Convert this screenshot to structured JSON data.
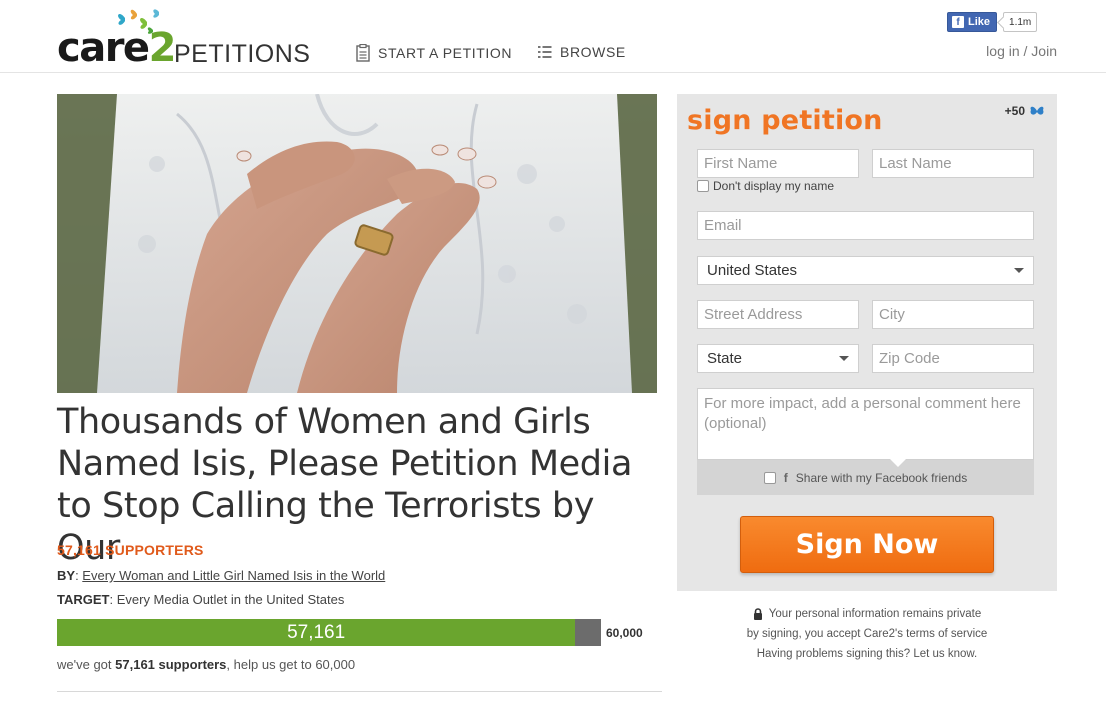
{
  "header": {
    "logo_brand": "care2",
    "logo_brand_main": "care",
    "logo_brand_num": "2",
    "logo_product": "PETITIONS",
    "nav": {
      "start_label": "START A PETITION",
      "browse_label": "BROWSE"
    },
    "facebook": {
      "like_label": "Like",
      "like_count": "1.1m"
    },
    "login_label": "log in / Join"
  },
  "petition": {
    "hero_alt": "Woman with hands crossed over her heart wearing a ring",
    "title": "Thousands of Women and Girls Named Isis, Please Petition Media to Stop Calling the Terrorists by Our",
    "supporters_label": "57,161 SUPPORTERS",
    "by_label": "BY",
    "by_value": "Every Woman and Little Girl Named Isis in the World",
    "target_label": "TARGET",
    "target_value": "Every Media Outlet in the United States",
    "progress": {
      "current": 57161,
      "current_display": "57,161",
      "goal": 60000,
      "goal_display": "60,000"
    },
    "goal_text_pre": "we've got ",
    "goal_text_bold": "57,161 supporters",
    "goal_text_post": ", help us get to 60,000"
  },
  "sign_form": {
    "title": "sign petition",
    "points": "+50",
    "first_name_placeholder": "First Name",
    "last_name_placeholder": "Last Name",
    "hide_name_label": "Don't display my name",
    "email_placeholder": "Email",
    "country_value": "United States",
    "street_placeholder": "Street Address",
    "city_placeholder": "City",
    "state_value": "State",
    "zip_placeholder": "Zip Code",
    "comment_placeholder": "For more impact, add a personal comment here (optional)",
    "fb_share_label": "Share with my Facebook friends",
    "submit_label": "Sign Now"
  },
  "privacy": {
    "line1": "Your personal information remains private",
    "line2": "by signing, you accept Care2's terms of service",
    "line3": "Having problems signing this? Let us know."
  },
  "colors": {
    "accent_orange": "#f07524",
    "supporters_orange": "#e05a1b",
    "progress_green": "#6aa52e",
    "progress_track": "#6c6c6c",
    "panel_bg": "#e6e6e6",
    "facebook_blue": "#4267b2"
  },
  "icons": [
    "butterfly-logo-icon",
    "document-icon",
    "list-icon",
    "facebook-icon",
    "butterfly-icon",
    "lock-icon",
    "chevron-down-icon"
  ]
}
